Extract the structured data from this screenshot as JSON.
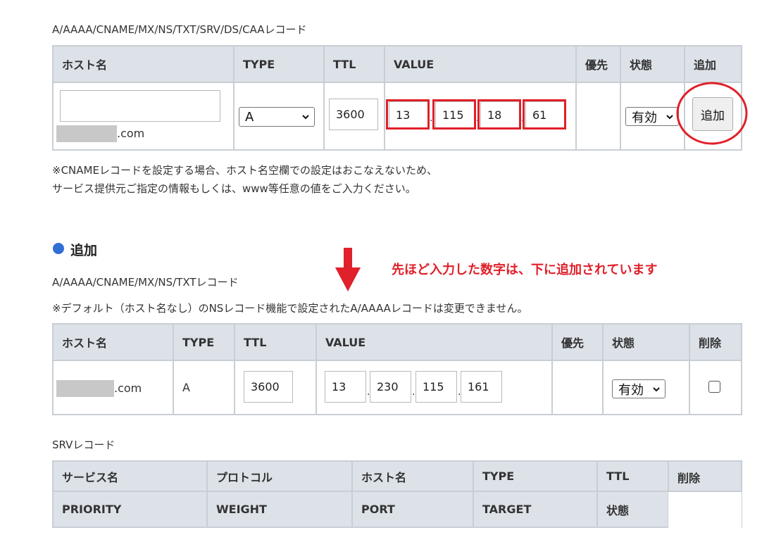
{
  "section1": {
    "title": "A/AAAA/CNAME/MX/NS/TXT/SRV/DS/CAAレコード",
    "headers": [
      "ホスト名",
      "TYPE",
      "TTL",
      "VALUE",
      "優先",
      "状態",
      "追加"
    ],
    "host_input_value": "",
    "host_suffix": ".com",
    "type_value": "A",
    "ttl_value": "3600",
    "ip_values": [
      "13",
      "115",
      "18",
      "61"
    ],
    "ip_separator": ".",
    "status_value": "有効",
    "add_button_label": "追加",
    "note_line1": "※CNAMEレコードを設定する場合、ホスト名空欄での設定はおこなえないため、",
    "note_line2": "サービス提供元ご指定の情報もしくは、www等任意の値をご入力ください。"
  },
  "annotation": {
    "text": "先ほど入力した数字は、下に追加されています",
    "color": "#e0202a"
  },
  "section2": {
    "heading": "追加",
    "subtitle": "A/AAAA/CNAME/MX/NS/TXTレコード",
    "note": "※デフォルト（ホスト名なし）のNSレコード機能で設定されたA/AAAAレコードは変更できません。",
    "headers": [
      "ホスト名",
      "TYPE",
      "TTL",
      "VALUE",
      "優先",
      "状態",
      "削除"
    ],
    "row": {
      "host_suffix": ".com",
      "type": "A",
      "ttl": "3600",
      "ip_values": [
        "13",
        "230",
        "115",
        "161"
      ],
      "ip_separator": ".",
      "status": "有効",
      "delete_checked": false
    }
  },
  "section3": {
    "title": "SRVレコード",
    "headers_row1": [
      "サービス名",
      "プロトコル",
      "ホスト名",
      "TYPE",
      "TTL",
      "削除"
    ],
    "headers_row2": [
      "PRIORITY",
      "WEIGHT",
      "PORT",
      "TARGET",
      "状態"
    ]
  },
  "colors": {
    "header_bg": "#dde2e8",
    "border": "#c9ced5",
    "accent_red": "#e0202a",
    "bullet_blue": "#2f6fd6"
  }
}
